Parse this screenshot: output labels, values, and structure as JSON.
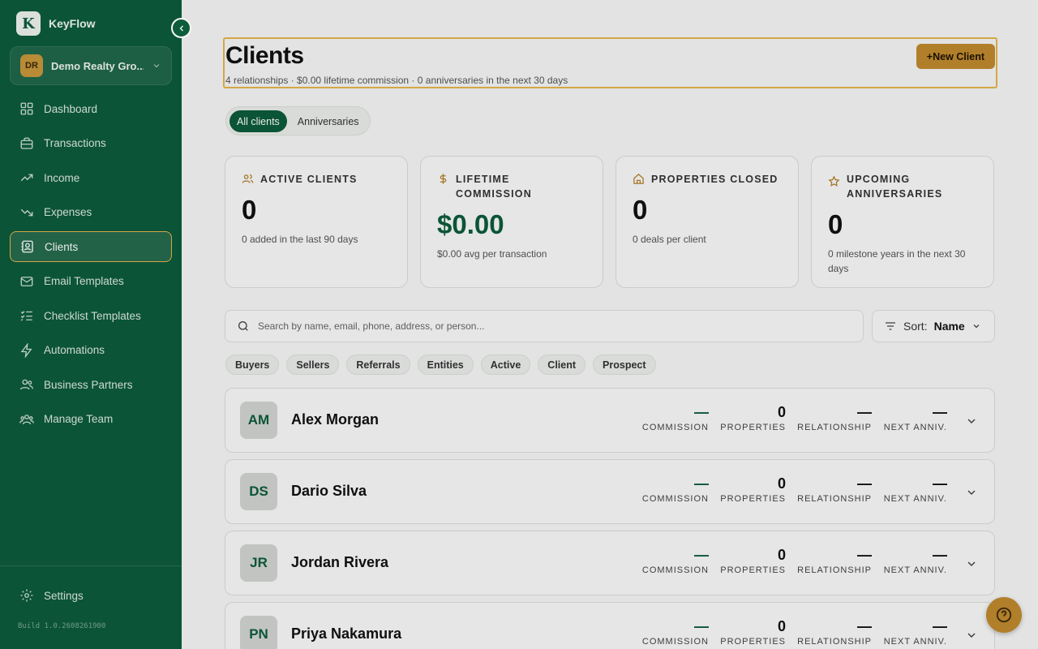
{
  "app": {
    "name": "KeyFlow",
    "logo_letter": "K"
  },
  "org": {
    "initials": "DR",
    "name": "Demo Realty Gro..."
  },
  "nav": [
    {
      "label": "Dashboard",
      "icon": "dashboard-icon"
    },
    {
      "label": "Transactions",
      "icon": "briefcase-icon"
    },
    {
      "label": "Income",
      "icon": "trend-up-icon"
    },
    {
      "label": "Expenses",
      "icon": "trend-down-icon"
    },
    {
      "label": "Clients",
      "icon": "contacts-icon",
      "active": true
    },
    {
      "label": "Email Templates",
      "icon": "mail-icon"
    },
    {
      "label": "Checklist Templates",
      "icon": "checklist-icon"
    },
    {
      "label": "Automations",
      "icon": "bolt-icon"
    },
    {
      "label": "Business Partners",
      "icon": "partners-icon"
    },
    {
      "label": "Manage Team",
      "icon": "team-icon"
    }
  ],
  "settings_label": "Settings",
  "build": "Build 1.0.2608261900",
  "header": {
    "title": "Clients",
    "subtitle": "4 relationships · $0.00 lifetime commission · 0 anniversaries in the next 30 days",
    "new_button": "+New Client"
  },
  "tabs": [
    "All clients",
    "Anniversaries"
  ],
  "stats": [
    {
      "label": "Active Clients",
      "value": "0",
      "note": "0 added in the last 90 days",
      "icon": "users-icon"
    },
    {
      "label": "Lifetime Commission",
      "value": "$0.00",
      "note": "$0.00 avg per transaction",
      "icon": "dollar-icon"
    },
    {
      "label": "Properties Closed",
      "value": "0",
      "note": "0 deals per client",
      "icon": "house-icon"
    },
    {
      "label": "Upcoming Anniversaries",
      "value": "0",
      "note": "0 milestone years in the next 30 days",
      "icon": "star-icon"
    }
  ],
  "search": {
    "placeholder": "Search by name, email, phone, address, or person..."
  },
  "sort": {
    "label": "Sort:",
    "value": "Name"
  },
  "filters": [
    "Buyers",
    "Sellers",
    "Referrals",
    "Entities",
    "Active",
    "Client",
    "Prospect"
  ],
  "metric_labels": {
    "commission": "COMMISSION",
    "properties": "PROPERTIES",
    "relationship": "RELATIONSHIP",
    "next_anniv": "NEXT ANNIV."
  },
  "clients": [
    {
      "initials": "AM",
      "name": "Alex Morgan",
      "commission": "—",
      "properties": "0",
      "relationship": "—",
      "next_anniv": "—"
    },
    {
      "initials": "DS",
      "name": "Dario Silva",
      "commission": "—",
      "properties": "0",
      "relationship": "—",
      "next_anniv": "—"
    },
    {
      "initials": "JR",
      "name": "Jordan Rivera",
      "commission": "—",
      "properties": "0",
      "relationship": "—",
      "next_anniv": "—"
    },
    {
      "initials": "PN",
      "name": "Priya Nakamura",
      "commission": "—",
      "properties": "0",
      "relationship": "—",
      "next_anniv": "—"
    }
  ],
  "colors": {
    "sidebar": "#0d5c3c",
    "accent": "#c08a2e",
    "highlight": "#e7b64a"
  }
}
